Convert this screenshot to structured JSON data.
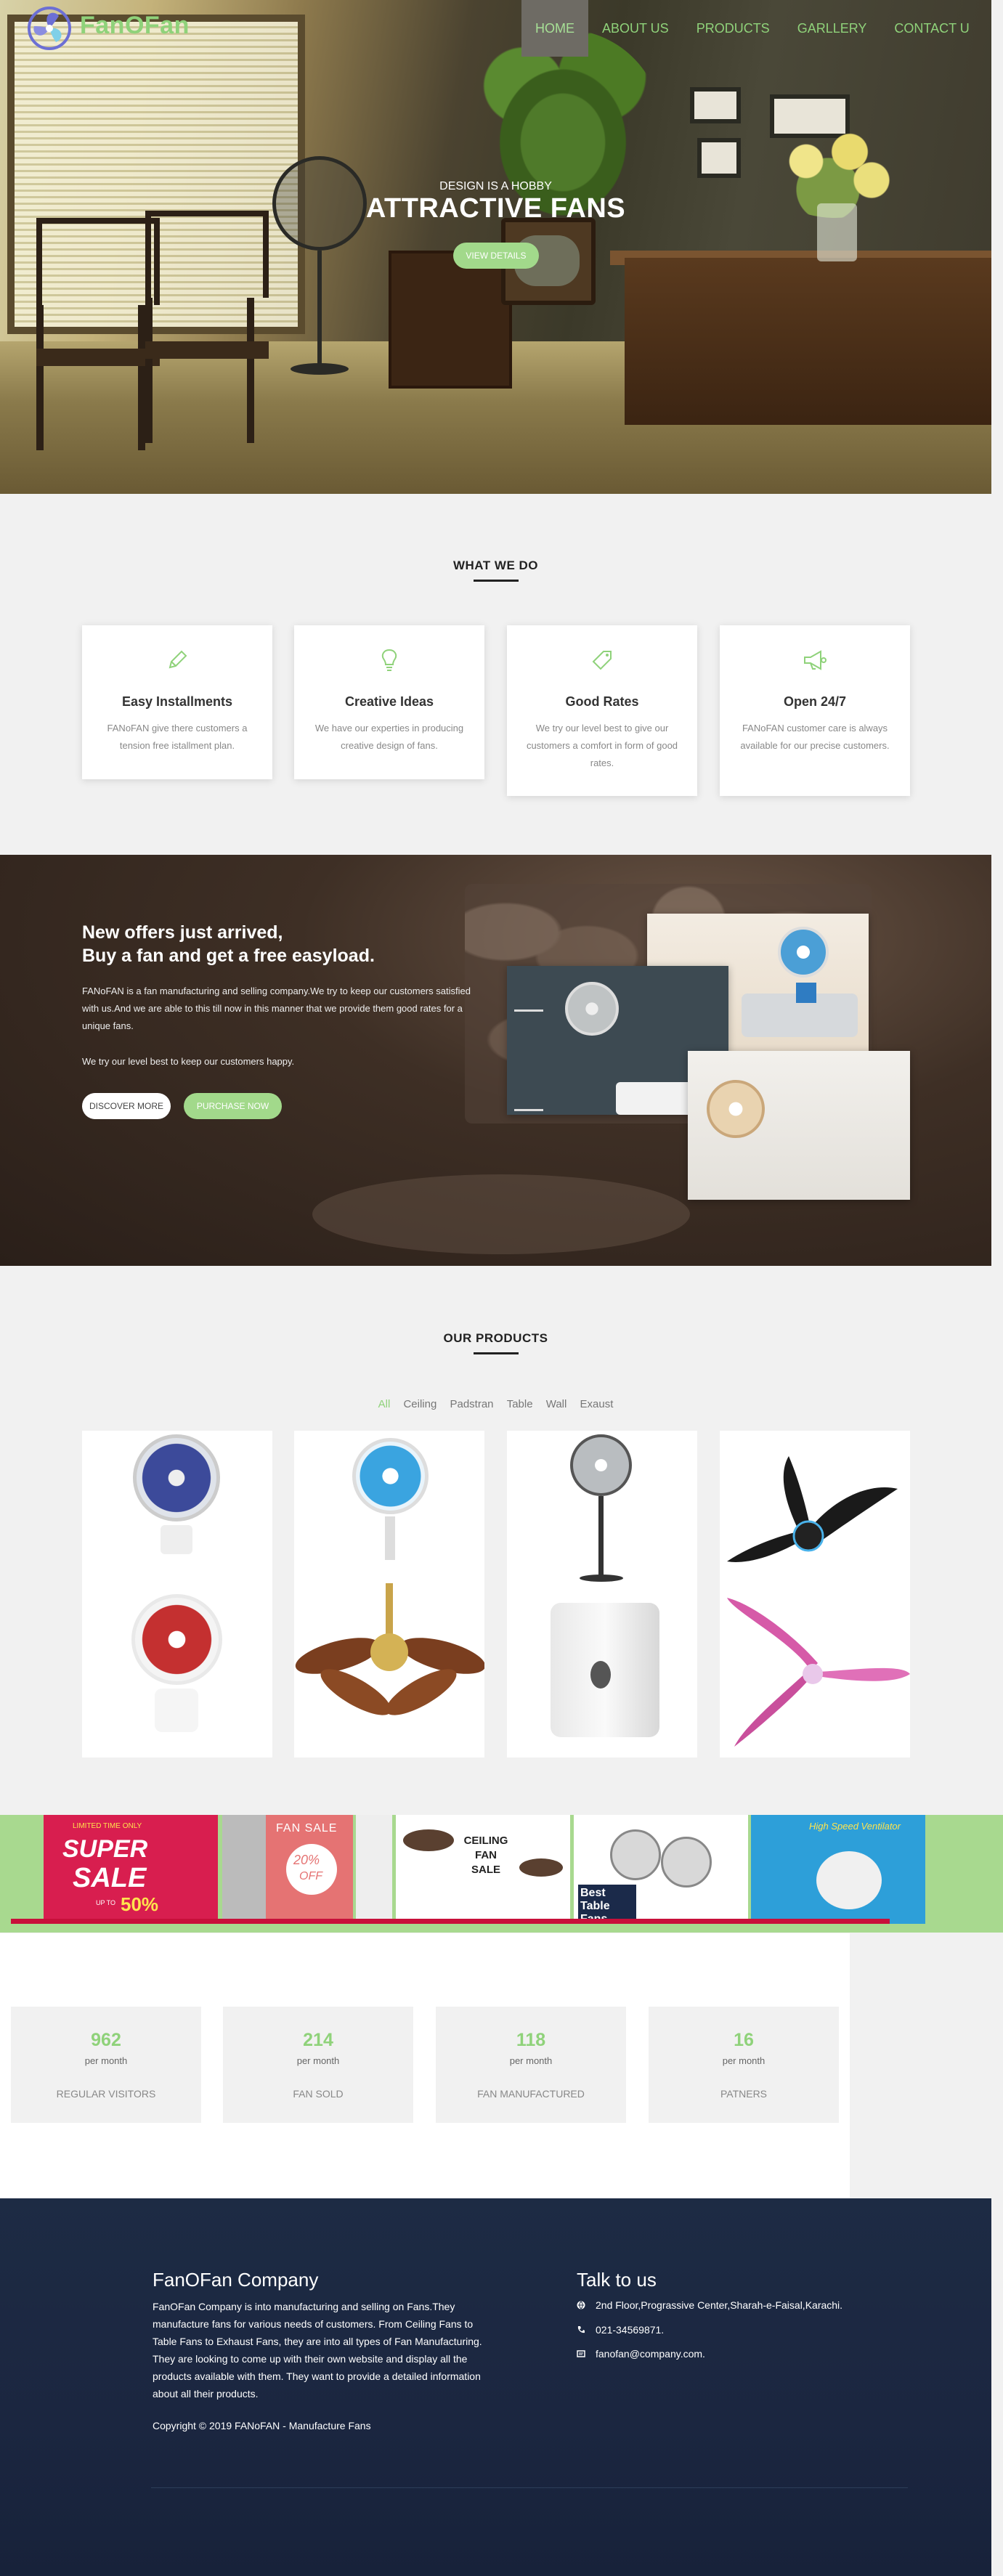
{
  "brand": {
    "name": "FanOFan",
    "logo_color": "#8fd27a"
  },
  "nav": {
    "items": [
      {
        "label": "HOME",
        "active": true
      },
      {
        "label": "ABOUT US",
        "active": false
      },
      {
        "label": "PRODUCTS",
        "active": false
      },
      {
        "label": "GARLLERY",
        "active": false
      },
      {
        "label": "CONTACT U",
        "active": false
      }
    ]
  },
  "hero": {
    "subtitle": "DESIGN IS A HOBBY",
    "title": "ATTRACTIVE FANS",
    "button": "VIEW DETAILS"
  },
  "services": {
    "title": "WHAT WE DO",
    "items": [
      {
        "icon": "pencil-icon",
        "title": "Easy Installments",
        "text": "FANoFAN give there customers a tension free istallment plan."
      },
      {
        "icon": "lightbulb-icon",
        "title": "Creative Ideas",
        "text": "We have our experties in producing creative design of fans."
      },
      {
        "icon": "tag-icon",
        "title": "Good Rates",
        "text": "We try our level best to give our customers a comfort in form of good rates."
      },
      {
        "icon": "megaphone-icon",
        "title": "Open 24/7",
        "text": "FANoFAN customer care is always available for our precise customers."
      }
    ]
  },
  "offer": {
    "heading_line1": "New offers just arrived,",
    "heading_line2": "Buy a fan and get a free easyload.",
    "paragraph1": "FANoFAN is a fan manufacturing and selling company.We try to keep our customers satisfied with us.And we are able to this till now in this manner that we provide them good rates for a unique fans.",
    "paragraph2": "We try our level best to keep our customers happy.",
    "btn_discover": "DISCOVER MORE",
    "btn_purchase": "PURCHASE NOW"
  },
  "products": {
    "title": "OUR PRODUCTS",
    "filters": [
      "All",
      "Ceiling",
      "Padstran",
      "Table",
      "Wall",
      "Exaust"
    ],
    "active_filter": "All"
  },
  "strip": {
    "sale_super": "SUPER",
    "sale_sale": "SALE",
    "sale_percent": "50%",
    "sale_upto": "UP TO",
    "sale_limited": "LIMITED TIME ONLY",
    "fan_sale": "FAN SALE",
    "fan_sale_pct": "20%",
    "fan_sale_off": "OFF",
    "ceiling_sale": "CEILING FAN SALE",
    "best_table": "Best Table Fans",
    "high_speed": "High Speed Ventilator"
  },
  "stats": [
    {
      "value": "962",
      "per": "per month",
      "label": "REGULAR VISITORS"
    },
    {
      "value": "214",
      "per": "per month",
      "label": "FAN SOLD"
    },
    {
      "value": "118",
      "per": "per month",
      "label": "FAN MANUFACTURED"
    },
    {
      "value": "16",
      "per": "per month",
      "label": "PATNERS"
    }
  ],
  "footer": {
    "company_title": "FanOFan Company",
    "company_text": "FanOFan Company is into manufacturing and selling on Fans.They manufacture fans for various needs of customers. From Ceiling Fans to Table Fans to Exhaust Fans, they are into all types of Fan Manufacturing. They are looking to come up with their own website and display all the products available with them. They want to provide a detailed information about all their products.",
    "copyright": "Copyright © 2019 FANoFAN - Manufacture Fans",
    "talk_title": "Talk to us",
    "address": "2nd Floor,Prograssive Center,Sharah-e-Faisal,Karachi.",
    "phone": "021-34569871.",
    "email": "fanofan@company.com."
  },
  "colors": {
    "accent": "#8fd27a",
    "footer_bg": "#1d2b44",
    "strip_bg": "#a8d98f"
  }
}
